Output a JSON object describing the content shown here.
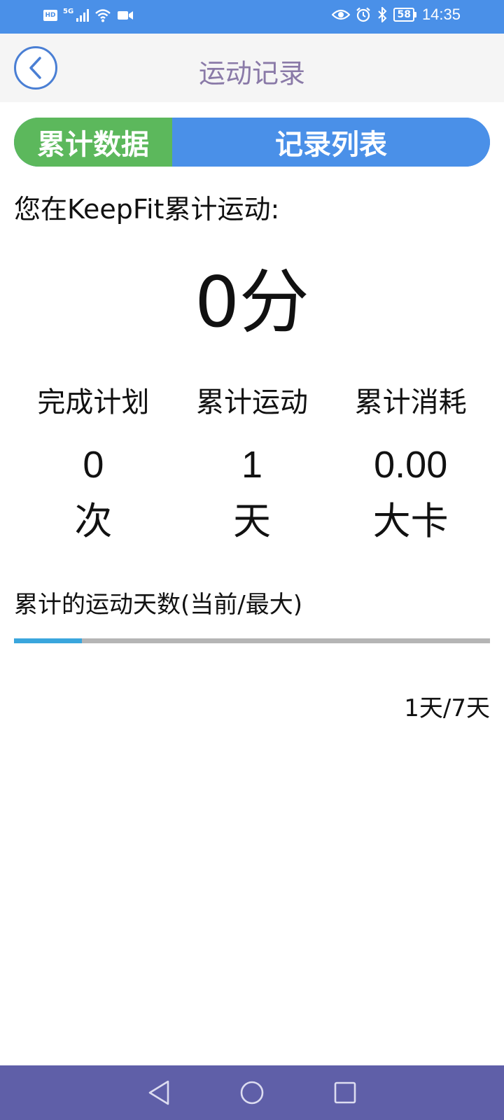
{
  "status_bar": {
    "hd": "HD",
    "network": "5G",
    "battery": "58",
    "time": "14:35",
    "icons": [
      "hd-icon",
      "signal-icon",
      "wifi-icon",
      "video-icon",
      "eye-icon",
      "alarm-icon",
      "bluetooth-icon",
      "battery-icon"
    ]
  },
  "header": {
    "title": "运动记录",
    "back_icon": "chevron-left-icon"
  },
  "tabs": [
    {
      "label": "累计数据",
      "active": true
    },
    {
      "label": "记录列表",
      "active": false
    }
  ],
  "intro": "您在KeepFit累计运动:",
  "total_time": "0分",
  "stats": [
    {
      "label": "完成计划",
      "value": "0",
      "unit": "次"
    },
    {
      "label": "累计运动",
      "value": "1",
      "unit": "天"
    },
    {
      "label": "累计消耗",
      "value": "0.00",
      "unit": "大卡"
    }
  ],
  "progress": {
    "label": "累计的运动天数(当前/最大)",
    "current": 1,
    "max": 7,
    "readout": "1天/7天"
  },
  "colors": {
    "status_bar": "#4a90e8",
    "tab_active": "#5cb85c",
    "tab_inactive": "#4a90e8",
    "title": "#8a7aa8",
    "progress_fill": "#3aa6dd",
    "progress_track": "#b5b5b5",
    "nav_bar": "#5f5fa8"
  },
  "nav": {
    "icons": [
      "nav-back-icon",
      "nav-home-icon",
      "nav-recents-icon"
    ]
  }
}
